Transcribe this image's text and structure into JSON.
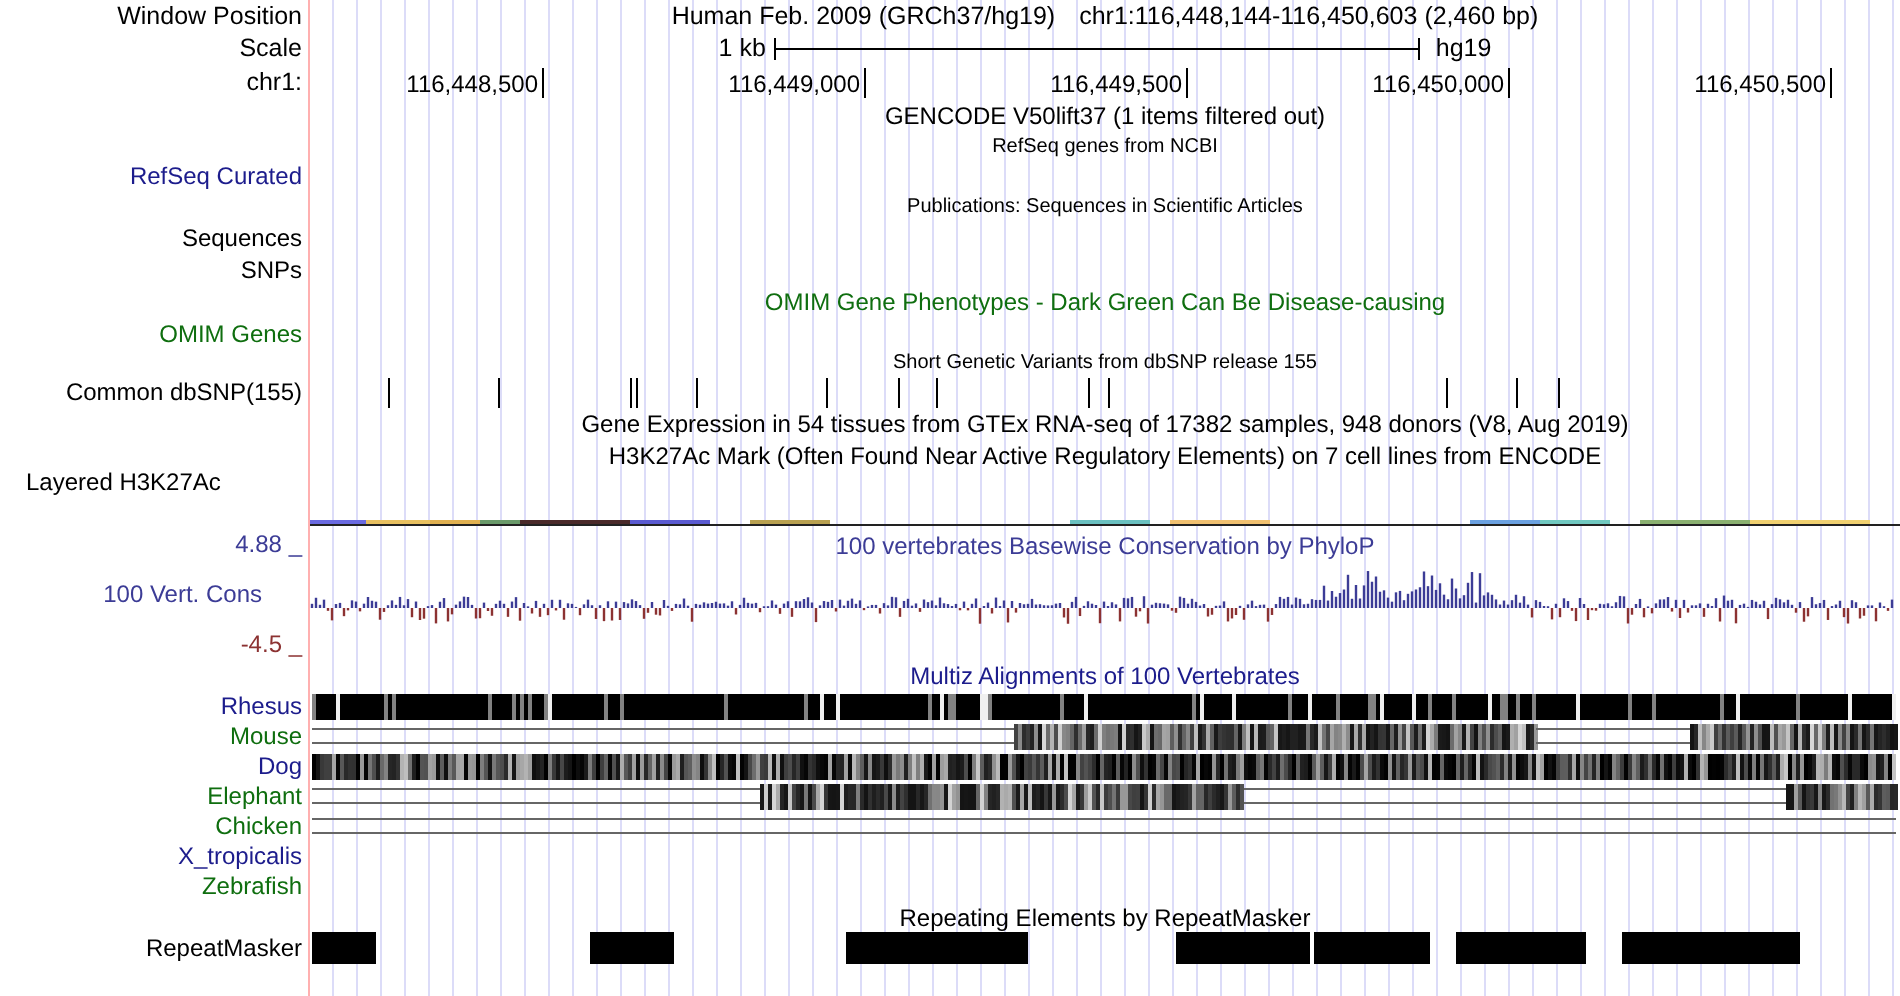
{
  "position_header": {
    "label": "Window Position",
    "genome": "Human Feb. 2009 (GRCh37/hg19)",
    "range": "chr1:116,448,144-116,450,603 (2,460 bp)"
  },
  "scale": {
    "label": "Scale",
    "length": "1 kb",
    "assembly": "hg19"
  },
  "ruler": {
    "label": "chr1:",
    "ticks": [
      "116,448,500",
      "116,449,000",
      "116,449,500",
      "116,450,000",
      "116,450,500"
    ]
  },
  "tracks": [
    {
      "kind": "title_only",
      "title": "GENCODE V50lift37 (1 items filtered out)",
      "color": "#000000"
    },
    {
      "kind": "genes",
      "title": "RefSeq genes from NCBI",
      "color": "#000000",
      "labels": [
        {
          "text": "RefSeq Curated",
          "color": "#1c1c8c"
        }
      ]
    },
    {
      "kind": "publications",
      "title": "Publications: Sequences in Scientific Articles",
      "color": "#000000",
      "labels": [
        {
          "text": "Sequences",
          "color": "#000000"
        },
        {
          "text": "SNPs",
          "color": "#000000"
        }
      ]
    },
    {
      "kind": "omim",
      "title": "OMIM Gene Phenotypes - Dark Green Can Be Disease-causing",
      "color": "#0f6e0f",
      "labels": [
        {
          "text": "OMIM Genes",
          "color": "#0f6e0f"
        }
      ]
    },
    {
      "kind": "snps",
      "title": "Short Genetic Variants from dbSNP release 155",
      "color": "#000000",
      "labels": [
        {
          "text": "Common dbSNP(155)",
          "color": "#000000"
        }
      ]
    },
    {
      "kind": "title_only",
      "title": "Gene Expression in 54 tissues from GTEx RNA-seq of 17382 samples, 948 donors (V8, Aug 2019)",
      "color": "#000000"
    },
    {
      "kind": "layered",
      "title": "H3K27Ac Mark (Often Found Near Active Regulatory Elements) on 7 cell lines from ENCODE",
      "color": "#000000",
      "labels": [
        {
          "text": "Layered H3K27Ac",
          "color": "#000000"
        }
      ]
    },
    {
      "kind": "wiggle",
      "title": "100 vertebrates Basewise Conservation by PhyloP",
      "color": "#3c3c96",
      "labels": [
        {
          "text": "4.88 _",
          "color": "#3c3c96"
        },
        {
          "text": "100 Vert. Cons",
          "color": "#3c3c96"
        },
        {
          "text": "-4.5 _",
          "color": "#8c3232"
        }
      ]
    },
    {
      "kind": "multiz",
      "title": "Multiz Alignments of 100 Vertebrates",
      "color": "#1c1c8c",
      "labels": [
        {
          "text": "Rhesus",
          "color": "#1c1c8c"
        },
        {
          "text": "Mouse",
          "color": "#0f6e0f"
        },
        {
          "text": "Dog",
          "color": "#1c1c8c"
        },
        {
          "text": "Elephant",
          "color": "#0f6e0f"
        },
        {
          "text": "Chicken",
          "color": "#0f6e0f"
        },
        {
          "text": "X_tropicalis",
          "color": "#1c1c8c"
        },
        {
          "text": "Zebrafish",
          "color": "#0f6e0f"
        }
      ]
    },
    {
      "kind": "repeats",
      "title": "Repeating Elements by RepeatMasker",
      "color": "#000000",
      "labels": [
        {
          "text": "RepeatMasker",
          "color": "#000000"
        }
      ]
    }
  ]
}
